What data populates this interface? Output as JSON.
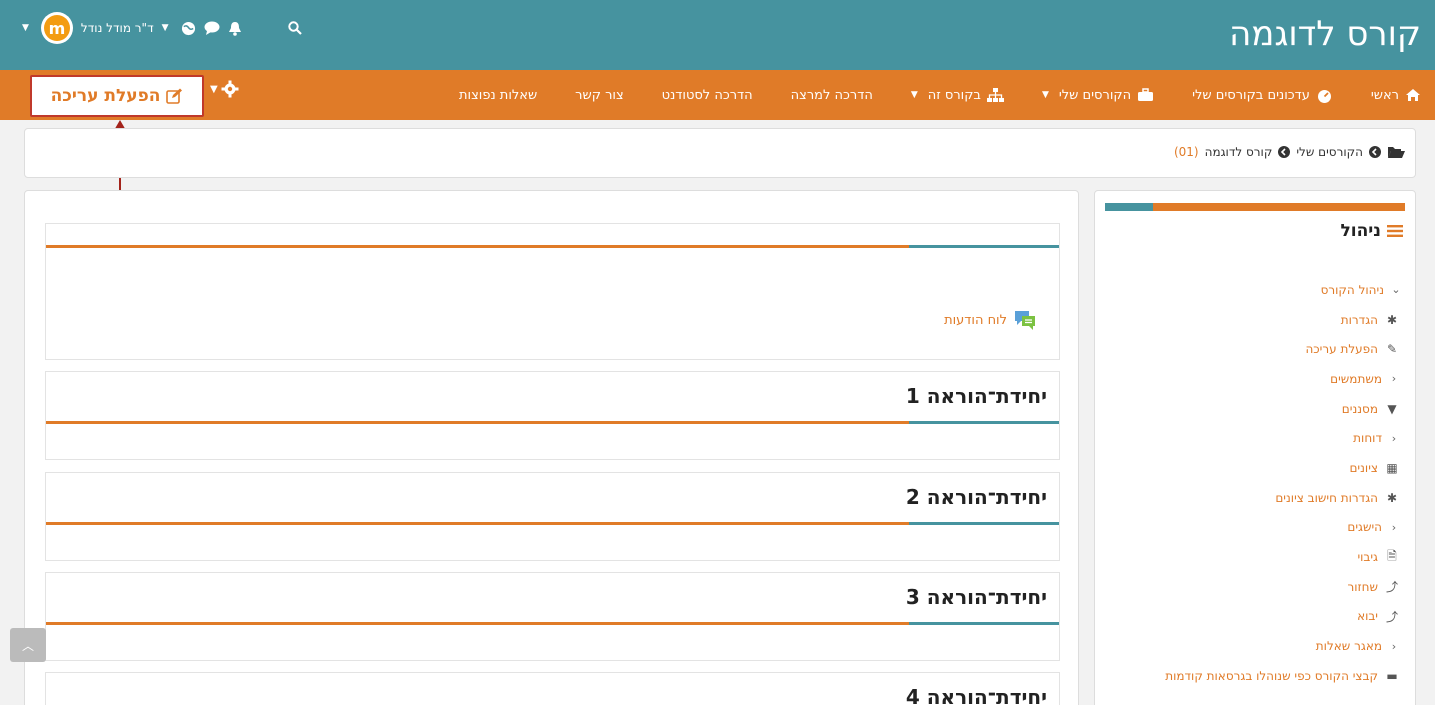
{
  "header": {
    "site_title": "קורס לדוגמה",
    "user_name": "ד\"ר מודל נודל"
  },
  "nav": {
    "items": [
      {
        "label": "ראשי",
        "icon": "home-icon"
      },
      {
        "label": "עדכונים בקורסים שלי",
        "icon": "dashboard-icon"
      },
      {
        "label": "הקורסים שלי",
        "icon": "briefcase-icon"
      },
      {
        "label": "בקורס זה",
        "icon": "sitemap-icon"
      },
      {
        "label": "הדרכה למרצה"
      },
      {
        "label": "הדרכה לסטודנט"
      },
      {
        "label": "צור קשר"
      },
      {
        "label": "שאלות נפוצות"
      }
    ],
    "edit_button": "הפעלת עריכה"
  },
  "breadcrumb": {
    "items": [
      "הקורסים שלי",
      "קורס לדוגמה"
    ],
    "course_id": "(01)"
  },
  "main": {
    "forum_link": "לוח הודעות",
    "sections": [
      "יחידת־הוראה 1",
      "יחידת־הוראה 2",
      "יחידת־הוראה 3",
      "יחידת־הוראה 4"
    ]
  },
  "side": {
    "title": "ניהול",
    "items": [
      {
        "label": "ניהול הקורס",
        "icon": "chevron-down-icon"
      },
      {
        "label": "הגדרות",
        "icon": "gear-icon"
      },
      {
        "label": "הפעלת עריכה",
        "icon": "pencil-icon"
      },
      {
        "label": "משתמשים",
        "icon": "chevron-right-icon"
      },
      {
        "label": "מסננים",
        "icon": "filter-icon"
      },
      {
        "label": "דוחות",
        "icon": "chevron-right-icon"
      },
      {
        "label": "ציונים",
        "icon": "table-icon"
      },
      {
        "label": "הגדרות חישוב ציונים",
        "icon": "gear-icon"
      },
      {
        "label": "הישגים",
        "icon": "chevron-right-icon"
      },
      {
        "label": "גיבוי",
        "icon": "file-icon"
      },
      {
        "label": "שחזור",
        "icon": "upload-icon"
      },
      {
        "label": "יבוא",
        "icon": "upload-icon"
      },
      {
        "label": "מאגר שאלות",
        "icon": "chevron-right-icon"
      },
      {
        "label": "קבצי הקורס כפי שנוהלו בגרסאות קודמות",
        "icon": "folder-icon"
      }
    ]
  },
  "colors": {
    "teal": "#46939f",
    "orange": "#e07b28",
    "annotation_red": "#c0392b"
  }
}
